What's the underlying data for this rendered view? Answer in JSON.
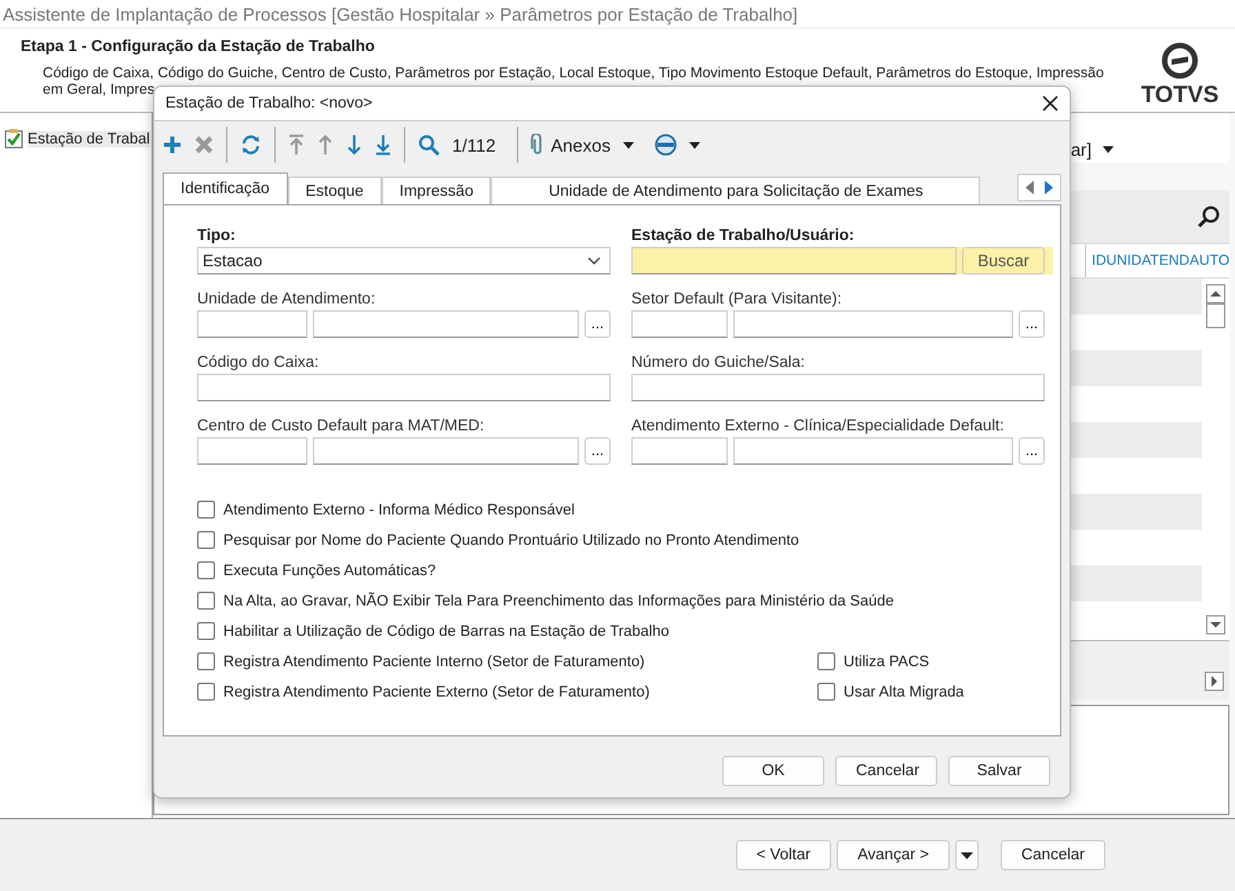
{
  "window": {
    "title": "Assistente de Implantação de Processos [Gestão Hospitalar » Parâmetros por Estação de Trabalho]"
  },
  "header": {
    "step": "Etapa 1 - Configuração da Estação de Trabalho",
    "description_lines": [
      "Código de Caixa, Código do Guiche, Centro de Custo, Parâmetros por Estação, Local Estoque, Tipo Movimento Estoque Default, Parâmetros do Estoque, Impressão",
      "em Geral, Impres"
    ],
    "logo": "TOTVS"
  },
  "tree": [
    {
      "label": "Estação de Trabal",
      "selected": true
    }
  ],
  "grid": {
    "filter": "ar]",
    "columns": [
      "IDUNIDATENDAUTO"
    ]
  },
  "wizard_buttons": [
    "< Voltar",
    "Avançar >",
    "Cancelar"
  ],
  "dialog": {
    "title": "Estação de Trabalho: <novo>",
    "toolbar": [
      {
        "kind": "add",
        "disabled": false
      },
      {
        "kind": "delete",
        "disabled": true
      },
      {
        "kind": "refresh",
        "disabled": false
      },
      {
        "kind": "first",
        "disabled": true
      },
      {
        "kind": "previous",
        "disabled": true
      },
      {
        "kind": "next",
        "disabled": false
      },
      {
        "kind": "last",
        "disabled": false
      },
      {
        "kind": "search",
        "disabled": false
      }
    ],
    "record_counter": "1/112",
    "attachments_label": "Anexos",
    "tabs": [
      {
        "label": "Identificação",
        "selected": true
      },
      {
        "label": "Estoque",
        "selected": false
      },
      {
        "label": "Impressão",
        "selected": false
      },
      {
        "label": "Unidade de Atendimento para Solicitação de Exames",
        "selected": false
      }
    ],
    "fields": [
      {
        "kind": "combo",
        "label": "Tipo:",
        "value": "Estacao",
        "required": true,
        "highlighted": false
      },
      {
        "kind": "search",
        "label": "Estação de Trabalho/Usuário:",
        "button": "Buscar",
        "required": true,
        "highlighted": true
      },
      {
        "kind": "lookup",
        "label": "Unidade de Atendimento:",
        "button": "...",
        "required": false,
        "highlighted": false
      },
      {
        "kind": "lookup",
        "label": "Setor Default (Para Visitante):",
        "button": "...",
        "required": false,
        "highlighted": false
      },
      {
        "kind": "text",
        "label": "Código do Caixa:",
        "required": false,
        "highlighted": false
      },
      {
        "kind": "text",
        "label": "Número do Guiche/Sala:",
        "required": false,
        "highlighted": false
      },
      {
        "kind": "lookup",
        "label": "Centro de Custo Default para MAT/MED:",
        "button": "...",
        "required": false,
        "highlighted": false
      },
      {
        "kind": "lookup",
        "label": "Atendimento Externo - Clínica/Especialidade Default:",
        "button": "...",
        "required": false,
        "highlighted": false
      }
    ],
    "checkboxes_left": [
      {
        "label": "Atendimento Externo - Informa Médico Responsável",
        "checked": false
      },
      {
        "label": "Pesquisar por Nome do Paciente Quando Prontuário Utilizado no Pronto Atendimento",
        "checked": false
      },
      {
        "label": "Executa Funções Automáticas?",
        "checked": false
      },
      {
        "label": "Na Alta, ao Gravar, NÃO Exibir Tela Para Preenchimento das Informações para Ministério da Saúde",
        "checked": false
      },
      {
        "label": "Habilitar a Utilização de Código de Barras na Estação de Trabalho",
        "checked": false
      },
      {
        "label": "Registra Atendimento Paciente Interno (Setor de Faturamento)",
        "checked": false
      },
      {
        "label": "Registra Atendimento Paciente Externo (Setor de Faturamento)",
        "checked": false
      }
    ],
    "checkboxes_right": [
      {
        "label": "Utiliza PACS",
        "checked": false
      },
      {
        "label": "Usar Alta Migrada",
        "checked": false
      }
    ],
    "buttons": [
      "OK",
      "Cancelar",
      "Salvar"
    ]
  }
}
